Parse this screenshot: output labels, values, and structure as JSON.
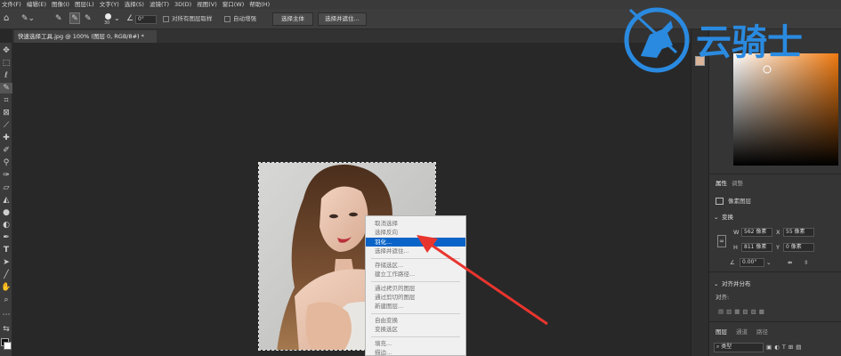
{
  "menubar": {
    "items": [
      "文件(F)",
      "编辑(E)",
      "图像(I)",
      "图层(L)",
      "文字(Y)",
      "选择(S)",
      "滤镜(T)",
      "3D(D)",
      "视图(V)",
      "窗口(W)",
      "帮助(H)"
    ]
  },
  "options": {
    "brush_size": "30",
    "angle_value": "0°",
    "sample_all_layers": "对所有图层取样",
    "auto_enhance": "自动增强",
    "select_subject": "选择主体",
    "select_and_mask": "选择并遮住..."
  },
  "document": {
    "tab_title": "快速选择工具.jpg @ 100% (图层 0, RGB/8#) *"
  },
  "context_menu": {
    "items": [
      {
        "label": "取消选择"
      },
      {
        "label": "选择反向"
      },
      {
        "label": "羽化...",
        "highlighted": true
      },
      {
        "label": "选择并遮住..."
      },
      {
        "label": "存储选区..."
      },
      {
        "label": "建立工作路径..."
      },
      {
        "label": "通过拷贝的图层"
      },
      {
        "label": "通过剪切的图层"
      },
      {
        "label": "新建图层..."
      },
      {
        "label": "自由变换"
      },
      {
        "label": "变换选区"
      },
      {
        "label": "填充..."
      },
      {
        "label": "描边..."
      }
    ]
  },
  "properties": {
    "tab_properties": "属性",
    "tab_adjustments": "调整",
    "layer_type": "像素图层",
    "transform_header": "变换",
    "w_label": "W",
    "w_value": "562 像素",
    "x_label": "X",
    "x_value": "55 像素",
    "h_label": "H",
    "h_value": "811 像素",
    "y_label": "Y",
    "y_value": "0 像素",
    "angle_value": "0.00°",
    "align_header": "对齐并分布",
    "align_label": "对齐:"
  },
  "layers": {
    "tab_layers": "图层",
    "tab_channels": "通道",
    "tab_paths": "路径",
    "filter_label": "类型"
  },
  "watermark": {
    "text": "云骑士"
  },
  "colors": {
    "highlight": "#0a64c8",
    "watermark": "#2a8ae0",
    "arrow": "#e8352e"
  }
}
